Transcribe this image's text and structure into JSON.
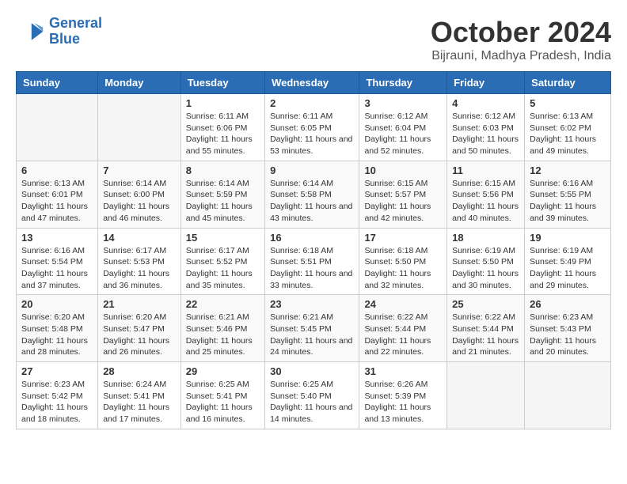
{
  "logo": {
    "line1": "General",
    "line2": "Blue"
  },
  "title": "October 2024",
  "subtitle": "Bijrauni, Madhya Pradesh, India",
  "weekdays": [
    "Sunday",
    "Monday",
    "Tuesday",
    "Wednesday",
    "Thursday",
    "Friday",
    "Saturday"
  ],
  "weeks": [
    [
      {
        "day": "",
        "sunrise": "",
        "sunset": "",
        "daylight": ""
      },
      {
        "day": "",
        "sunrise": "",
        "sunset": "",
        "daylight": ""
      },
      {
        "day": "1",
        "sunrise": "Sunrise: 6:11 AM",
        "sunset": "Sunset: 6:06 PM",
        "daylight": "Daylight: 11 hours and 55 minutes."
      },
      {
        "day": "2",
        "sunrise": "Sunrise: 6:11 AM",
        "sunset": "Sunset: 6:05 PM",
        "daylight": "Daylight: 11 hours and 53 minutes."
      },
      {
        "day": "3",
        "sunrise": "Sunrise: 6:12 AM",
        "sunset": "Sunset: 6:04 PM",
        "daylight": "Daylight: 11 hours and 52 minutes."
      },
      {
        "day": "4",
        "sunrise": "Sunrise: 6:12 AM",
        "sunset": "Sunset: 6:03 PM",
        "daylight": "Daylight: 11 hours and 50 minutes."
      },
      {
        "day": "5",
        "sunrise": "Sunrise: 6:13 AM",
        "sunset": "Sunset: 6:02 PM",
        "daylight": "Daylight: 11 hours and 49 minutes."
      }
    ],
    [
      {
        "day": "6",
        "sunrise": "Sunrise: 6:13 AM",
        "sunset": "Sunset: 6:01 PM",
        "daylight": "Daylight: 11 hours and 47 minutes."
      },
      {
        "day": "7",
        "sunrise": "Sunrise: 6:14 AM",
        "sunset": "Sunset: 6:00 PM",
        "daylight": "Daylight: 11 hours and 46 minutes."
      },
      {
        "day": "8",
        "sunrise": "Sunrise: 6:14 AM",
        "sunset": "Sunset: 5:59 PM",
        "daylight": "Daylight: 11 hours and 45 minutes."
      },
      {
        "day": "9",
        "sunrise": "Sunrise: 6:14 AM",
        "sunset": "Sunset: 5:58 PM",
        "daylight": "Daylight: 11 hours and 43 minutes."
      },
      {
        "day": "10",
        "sunrise": "Sunrise: 6:15 AM",
        "sunset": "Sunset: 5:57 PM",
        "daylight": "Daylight: 11 hours and 42 minutes."
      },
      {
        "day": "11",
        "sunrise": "Sunrise: 6:15 AM",
        "sunset": "Sunset: 5:56 PM",
        "daylight": "Daylight: 11 hours and 40 minutes."
      },
      {
        "day": "12",
        "sunrise": "Sunrise: 6:16 AM",
        "sunset": "Sunset: 5:55 PM",
        "daylight": "Daylight: 11 hours and 39 minutes."
      }
    ],
    [
      {
        "day": "13",
        "sunrise": "Sunrise: 6:16 AM",
        "sunset": "Sunset: 5:54 PM",
        "daylight": "Daylight: 11 hours and 37 minutes."
      },
      {
        "day": "14",
        "sunrise": "Sunrise: 6:17 AM",
        "sunset": "Sunset: 5:53 PM",
        "daylight": "Daylight: 11 hours and 36 minutes."
      },
      {
        "day": "15",
        "sunrise": "Sunrise: 6:17 AM",
        "sunset": "Sunset: 5:52 PM",
        "daylight": "Daylight: 11 hours and 35 minutes."
      },
      {
        "day": "16",
        "sunrise": "Sunrise: 6:18 AM",
        "sunset": "Sunset: 5:51 PM",
        "daylight": "Daylight: 11 hours and 33 minutes."
      },
      {
        "day": "17",
        "sunrise": "Sunrise: 6:18 AM",
        "sunset": "Sunset: 5:50 PM",
        "daylight": "Daylight: 11 hours and 32 minutes."
      },
      {
        "day": "18",
        "sunrise": "Sunrise: 6:19 AM",
        "sunset": "Sunset: 5:50 PM",
        "daylight": "Daylight: 11 hours and 30 minutes."
      },
      {
        "day": "19",
        "sunrise": "Sunrise: 6:19 AM",
        "sunset": "Sunset: 5:49 PM",
        "daylight": "Daylight: 11 hours and 29 minutes."
      }
    ],
    [
      {
        "day": "20",
        "sunrise": "Sunrise: 6:20 AM",
        "sunset": "Sunset: 5:48 PM",
        "daylight": "Daylight: 11 hours and 28 minutes."
      },
      {
        "day": "21",
        "sunrise": "Sunrise: 6:20 AM",
        "sunset": "Sunset: 5:47 PM",
        "daylight": "Daylight: 11 hours and 26 minutes."
      },
      {
        "day": "22",
        "sunrise": "Sunrise: 6:21 AM",
        "sunset": "Sunset: 5:46 PM",
        "daylight": "Daylight: 11 hours and 25 minutes."
      },
      {
        "day": "23",
        "sunrise": "Sunrise: 6:21 AM",
        "sunset": "Sunset: 5:45 PM",
        "daylight": "Daylight: 11 hours and 24 minutes."
      },
      {
        "day": "24",
        "sunrise": "Sunrise: 6:22 AM",
        "sunset": "Sunset: 5:44 PM",
        "daylight": "Daylight: 11 hours and 22 minutes."
      },
      {
        "day": "25",
        "sunrise": "Sunrise: 6:22 AM",
        "sunset": "Sunset: 5:44 PM",
        "daylight": "Daylight: 11 hours and 21 minutes."
      },
      {
        "day": "26",
        "sunrise": "Sunrise: 6:23 AM",
        "sunset": "Sunset: 5:43 PM",
        "daylight": "Daylight: 11 hours and 20 minutes."
      }
    ],
    [
      {
        "day": "27",
        "sunrise": "Sunrise: 6:23 AM",
        "sunset": "Sunset: 5:42 PM",
        "daylight": "Daylight: 11 hours and 18 minutes."
      },
      {
        "day": "28",
        "sunrise": "Sunrise: 6:24 AM",
        "sunset": "Sunset: 5:41 PM",
        "daylight": "Daylight: 11 hours and 17 minutes."
      },
      {
        "day": "29",
        "sunrise": "Sunrise: 6:25 AM",
        "sunset": "Sunset: 5:41 PM",
        "daylight": "Daylight: 11 hours and 16 minutes."
      },
      {
        "day": "30",
        "sunrise": "Sunrise: 6:25 AM",
        "sunset": "Sunset: 5:40 PM",
        "daylight": "Daylight: 11 hours and 14 minutes."
      },
      {
        "day": "31",
        "sunrise": "Sunrise: 6:26 AM",
        "sunset": "Sunset: 5:39 PM",
        "daylight": "Daylight: 11 hours and 13 minutes."
      },
      {
        "day": "",
        "sunrise": "",
        "sunset": "",
        "daylight": ""
      },
      {
        "day": "",
        "sunrise": "",
        "sunset": "",
        "daylight": ""
      }
    ]
  ]
}
